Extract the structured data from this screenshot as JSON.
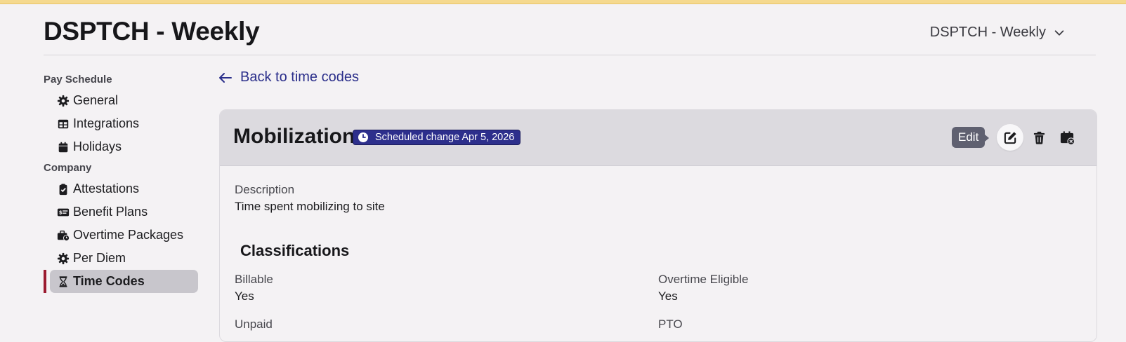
{
  "page": {
    "title": "DSPTCH - Weekly",
    "schedule_selector": "DSPTCH - Weekly"
  },
  "sidebar": {
    "sections": [
      {
        "label": "Pay Schedule",
        "items": [
          {
            "label": "General",
            "icon": "gear-icon"
          },
          {
            "label": "Integrations",
            "icon": "table-icon"
          },
          {
            "label": "Holidays",
            "icon": "calendar-icon"
          }
        ]
      },
      {
        "label": "Company",
        "items": [
          {
            "label": "Attestations",
            "icon": "clipboard-check-icon"
          },
          {
            "label": "Benefit Plans",
            "icon": "money-check-icon"
          },
          {
            "label": "Overtime Packages",
            "icon": "briefcase-clock-icon"
          },
          {
            "label": "Per Diem",
            "icon": "gear-icon"
          },
          {
            "label": "Time Codes",
            "icon": "hourglass-icon",
            "active": true
          }
        ]
      }
    ]
  },
  "back_link": "Back to time codes",
  "time_code": {
    "name": "Mobilization",
    "badge": "Scheduled change Apr 5, 2026",
    "tooltip": "Edit",
    "actions": [
      "edit-icon",
      "trash-icon",
      "calendar-cancel-icon"
    ],
    "description_label": "Description",
    "description": "Time spent mobilizing to site",
    "classifications_title": "Classifications",
    "fields": {
      "billable_label": "Billable",
      "billable": "Yes",
      "overtime_label": "Overtime Eligible",
      "overtime": "Yes",
      "unpaid_label": "Unpaid",
      "pto_label": "PTO"
    }
  },
  "colors": {
    "accent": "#2d2f8c",
    "active_marker": "#9b1b30",
    "top_banner": "#f5d98e"
  }
}
